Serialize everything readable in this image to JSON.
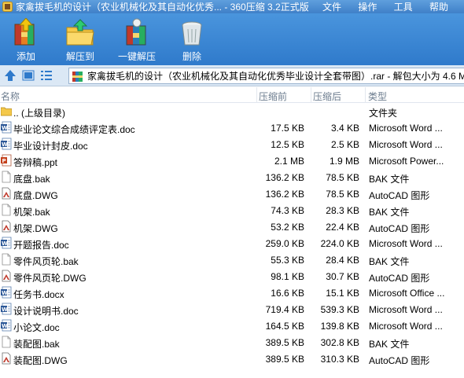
{
  "window": {
    "title": "家禽拔毛机的设计（农业机械化及其自动化优秀... - 360压缩 3.2正式版",
    "menu": [
      "文件",
      "操作",
      "工具",
      "帮助"
    ]
  },
  "toolbar": {
    "buttons": [
      {
        "label": "添加",
        "icon": "add-books-icon"
      },
      {
        "label": "解压到",
        "icon": "extract-folder-icon"
      },
      {
        "label": "一键解压",
        "icon": "one-click-extract-icon"
      },
      {
        "label": "删除",
        "icon": "trash-bin-icon"
      }
    ]
  },
  "address": {
    "path": "家禽拔毛机的设计（农业机械化及其自动化优秀毕业设计全套带图）.rar - 解包大小为 4.6 M"
  },
  "columns": {
    "name": "名称",
    "size": "压缩前",
    "packed": "压缩后",
    "type": "类型"
  },
  "files": [
    {
      "name": ".. (上级目录)",
      "size": "",
      "packed": "",
      "type": "文件夹",
      "icon": "folder"
    },
    {
      "name": "毕业论文综合成绩评定表.doc",
      "size": "17.5 KB",
      "packed": "3.4 KB",
      "type": "Microsoft Word ...",
      "icon": "word"
    },
    {
      "name": "毕业设计封皮.doc",
      "size": "12.5 KB",
      "packed": "2.5 KB",
      "type": "Microsoft Word ...",
      "icon": "word"
    },
    {
      "name": "答辩稿.ppt",
      "size": "2.1 MB",
      "packed": "1.9 MB",
      "type": "Microsoft Power...",
      "icon": "ppt"
    },
    {
      "name": "底盘.bak",
      "size": "136.2 KB",
      "packed": "78.5 KB",
      "type": "BAK 文件",
      "icon": "blank"
    },
    {
      "name": "底盘.DWG",
      "size": "136.2 KB",
      "packed": "78.5 KB",
      "type": "AutoCAD 图形",
      "icon": "dwg"
    },
    {
      "name": "机架.bak",
      "size": "74.3 KB",
      "packed": "28.3 KB",
      "type": "BAK 文件",
      "icon": "blank"
    },
    {
      "name": "机架.DWG",
      "size": "53.2 KB",
      "packed": "22.4 KB",
      "type": "AutoCAD 图形",
      "icon": "dwg"
    },
    {
      "name": "开题报告.doc",
      "size": "259.0 KB",
      "packed": "224.0 KB",
      "type": "Microsoft Word ...",
      "icon": "word"
    },
    {
      "name": "零件风页轮.bak",
      "size": "55.3 KB",
      "packed": "28.4 KB",
      "type": "BAK 文件",
      "icon": "blank"
    },
    {
      "name": "零件风页轮.DWG",
      "size": "98.1 KB",
      "packed": "30.7 KB",
      "type": "AutoCAD 图形",
      "icon": "dwg"
    },
    {
      "name": "任务书.docx",
      "size": "16.6 KB",
      "packed": "15.1 KB",
      "type": "Microsoft Office ...",
      "icon": "word"
    },
    {
      "name": "设计说明书.doc",
      "size": "719.4 KB",
      "packed": "539.3 KB",
      "type": "Microsoft Word ...",
      "icon": "word"
    },
    {
      "name": "小论文.doc",
      "size": "164.5 KB",
      "packed": "139.8 KB",
      "type": "Microsoft Word ...",
      "icon": "word"
    },
    {
      "name": "装配图.bak",
      "size": "389.5 KB",
      "packed": "302.8 KB",
      "type": "BAK 文件",
      "icon": "blank"
    },
    {
      "name": "装配图.DWG",
      "size": "389.5 KB",
      "packed": "310.3 KB",
      "type": "AutoCAD 图形",
      "icon": "dwg"
    }
  ]
}
